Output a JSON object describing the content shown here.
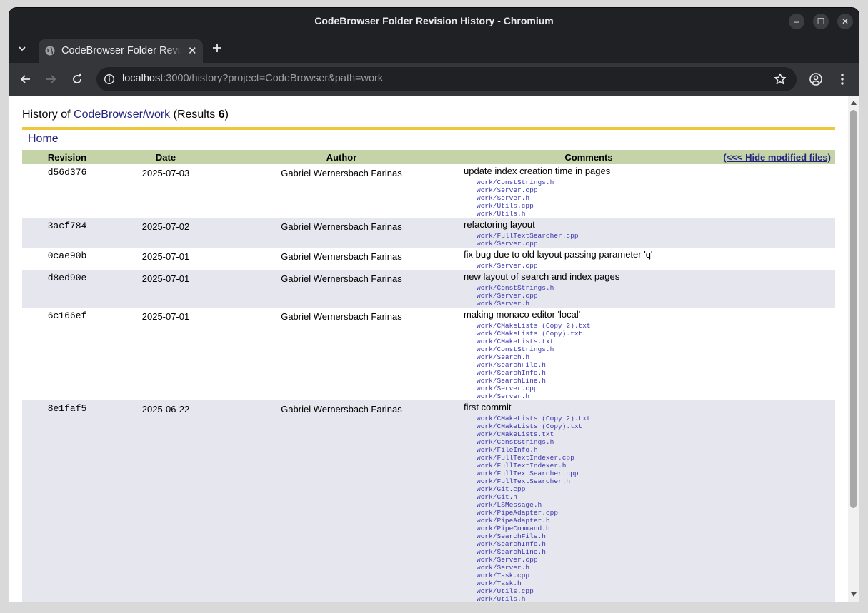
{
  "window": {
    "title": "CodeBrowser Folder Revision History - Chromium",
    "controls": {
      "minimize": "–",
      "maximize": "☐",
      "close": "✕"
    }
  },
  "tabs": [
    {
      "title": "CodeBrowser Folder Revision History",
      "close": "✕"
    }
  ],
  "toolbar": {
    "url_host": "localhost",
    "url_rest": ":3000/history?project=CodeBrowser&path=work"
  },
  "page": {
    "history_prefix": "History of ",
    "project_path": "CodeBrowser/work",
    "results_prefix": " (Results ",
    "results_count": "6",
    "results_suffix": ")",
    "home_link": "Home",
    "columns": {
      "revision": "Revision",
      "date": "Date",
      "author": "Author",
      "comments": "Comments",
      "hide_files": "(<<< Hide modified files)"
    },
    "rows": [
      {
        "revision": "d56d376",
        "date": "2025-07-03",
        "author": "Gabriel Wernersbach Farinas",
        "comment": "update index creation time in pages",
        "files": [
          "work/ConstStrings.h",
          "work/Server.cpp",
          "work/Server.h",
          "work/Utils.cpp",
          "work/Utils.h"
        ]
      },
      {
        "revision": "3acf784",
        "date": "2025-07-02",
        "author": "Gabriel Wernersbach Farinas",
        "comment": "refactoring layout",
        "files": [
          "work/FullTextSearcher.cpp",
          "work/Server.cpp"
        ]
      },
      {
        "revision": "0cae90b",
        "date": "2025-07-01",
        "author": "Gabriel Wernersbach Farinas",
        "comment": "fix bug due to old layout passing parameter 'q'",
        "files": [
          "work/Server.cpp"
        ]
      },
      {
        "revision": "d8ed90e",
        "date": "2025-07-01",
        "author": "Gabriel Wernersbach Farinas",
        "comment": "new layout of search and index pages",
        "files": [
          "work/ConstStrings.h",
          "work/Server.cpp",
          "work/Server.h"
        ]
      },
      {
        "revision": "6c166ef",
        "date": "2025-07-01",
        "author": "Gabriel Wernersbach Farinas",
        "comment": "making monaco editor 'local'",
        "files": [
          "work/CMakeLists (Copy 2).txt",
          "work/CMakeLists (Copy).txt",
          "work/CMakeLists.txt",
          "work/ConstStrings.h",
          "work/Search.h",
          "work/SearchFile.h",
          "work/SearchInfo.h",
          "work/SearchLine.h",
          "work/Server.cpp",
          "work/Server.h"
        ]
      },
      {
        "revision": "8e1faf5",
        "date": "2025-06-22",
        "author": "Gabriel Wernersbach Farinas",
        "comment": "first commit",
        "files": [
          "work/CMakeLists (Copy 2).txt",
          "work/CMakeLists (Copy).txt",
          "work/CMakeLists.txt",
          "work/ConstStrings.h",
          "work/FileInfo.h",
          "work/FullTextIndexer.cpp",
          "work/FullTextIndexer.h",
          "work/FullTextSearcher.cpp",
          "work/FullTextSearcher.h",
          "work/Git.cpp",
          "work/Git.h",
          "work/LSMessage.h",
          "work/PipeAdapter.cpp",
          "work/PipeAdapter.h",
          "work/PipeCommand.h",
          "work/SearchFile.h",
          "work/SearchInfo.h",
          "work/SearchLine.h",
          "work/Server.cpp",
          "work/Server.h",
          "work/Task.cpp",
          "work/Task.h",
          "work/Utils.cpp",
          "work/Utils.h"
        ]
      }
    ]
  }
}
